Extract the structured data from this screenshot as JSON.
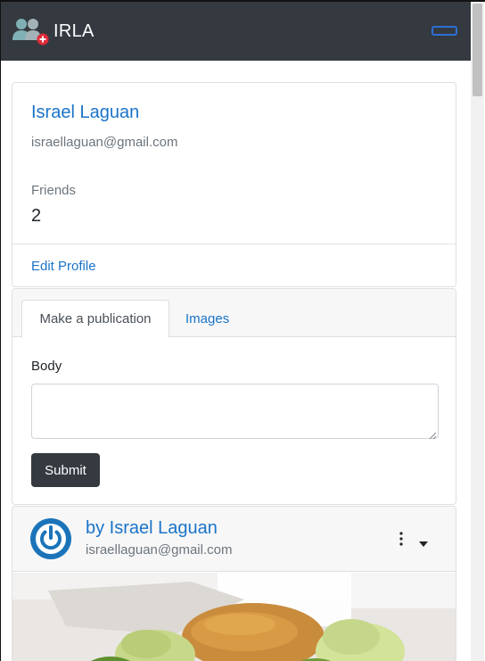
{
  "navbar": {
    "brand": "IRLA",
    "brand_icon": "users-add-icon",
    "toggler_icon": "menu-toggle-icon",
    "background": "#343a40",
    "toggler_color": "#2f6fd6"
  },
  "profile": {
    "name": "Israel Laguan",
    "email": "israellaguan@gmail.com",
    "friends_label": "Friends",
    "friends_count": "2",
    "edit_link": "Edit Profile"
  },
  "composer": {
    "tabs": [
      {
        "label": "Make a publication",
        "active": true
      },
      {
        "label": "Images",
        "active": false
      }
    ],
    "body_label": "Body",
    "body_value": "",
    "submit_label": "Submit"
  },
  "publication": {
    "author": "by Israel Laguan",
    "email": "israellaguan@gmail.com",
    "avatar_icon": "power-avatar-icon",
    "menu_icon": "kebab-menu-icon",
    "dropdown_icon": "caret-down-icon",
    "image": "food-photo"
  },
  "colors": {
    "link": "#1a73c8",
    "muted": "#6c757d",
    "dark_button": "#343a40",
    "avatar_blue": "#1b74b9"
  }
}
